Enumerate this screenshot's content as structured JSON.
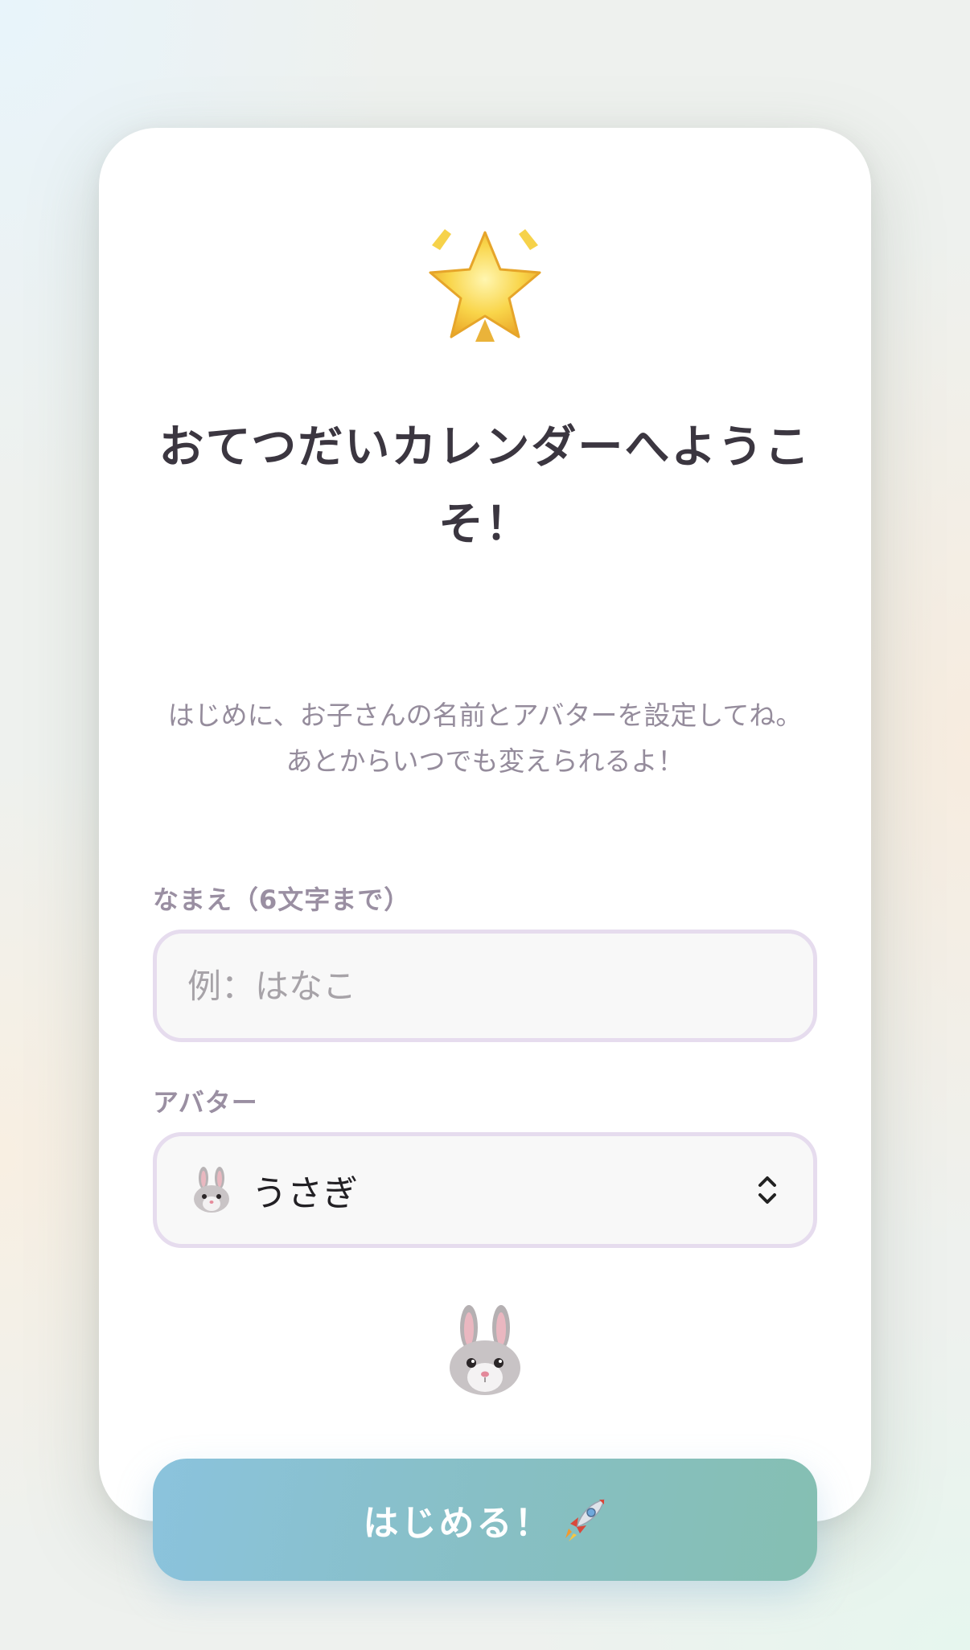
{
  "welcome": {
    "title": "おてつだいカレンダーへようこそ！",
    "subtitle_line1": "はじめに、お子さんの名前とアバターを設定してね。",
    "subtitle_line2": "あとからいつでも変えられるよ！",
    "hero_icon": "glowing-star-icon"
  },
  "form": {
    "name": {
      "label": "なまえ（6文字まで）",
      "placeholder": "例：はなこ",
      "value": ""
    },
    "avatar": {
      "label": "アバター",
      "selected_icon": "rabbit-face-icon",
      "selected_value": "うさぎ"
    },
    "preview_icon": "rabbit-face-icon"
  },
  "actions": {
    "start_label": "はじめる！",
    "start_icon": "rocket-icon"
  },
  "colors": {
    "title": "#3b3640",
    "subtitle": "#958c9c",
    "label": "#9a8fa2",
    "input_border": "#e6dcee",
    "button_start": "#8bc3dd",
    "button_end": "#85bfb2"
  }
}
